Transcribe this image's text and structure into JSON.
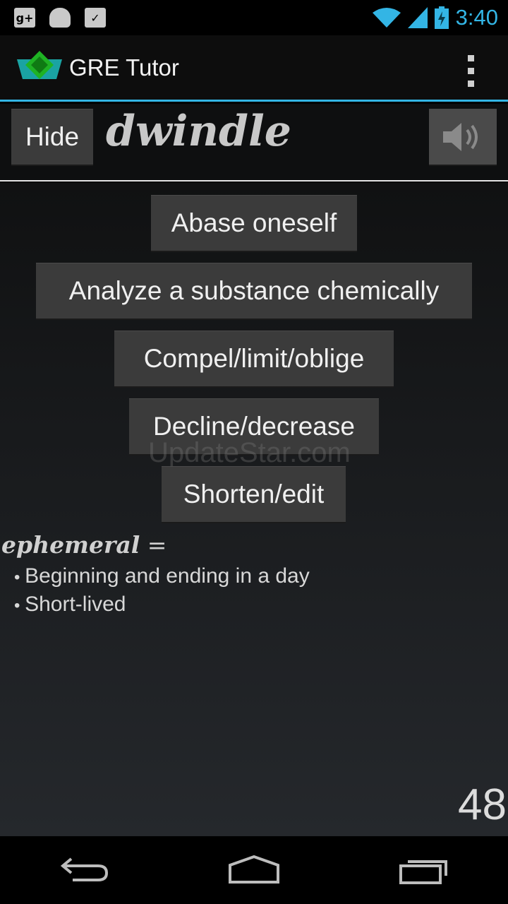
{
  "status_bar": {
    "time": "3:40",
    "icons": [
      "google-plus-icon",
      "android-icon",
      "store-check-icon",
      "wifi-icon",
      "signal-icon",
      "battery-icon"
    ]
  },
  "action_bar": {
    "title": "GRE Tutor",
    "accent_color": "#33b5e5"
  },
  "quiz": {
    "hide_label": "Hide",
    "word": "dwindle",
    "choices": [
      "Abase oneself",
      "Analyze a substance chemically",
      "Compel/limit/oblige",
      "Decline/decrease",
      "Shorten/edit"
    ]
  },
  "watermark": "UpdateStar.com",
  "previous": {
    "word": "ephemeral",
    "equals": " =",
    "definitions": [
      "Beginning and ending in a day",
      "Short-lived"
    ]
  },
  "counter": "48"
}
